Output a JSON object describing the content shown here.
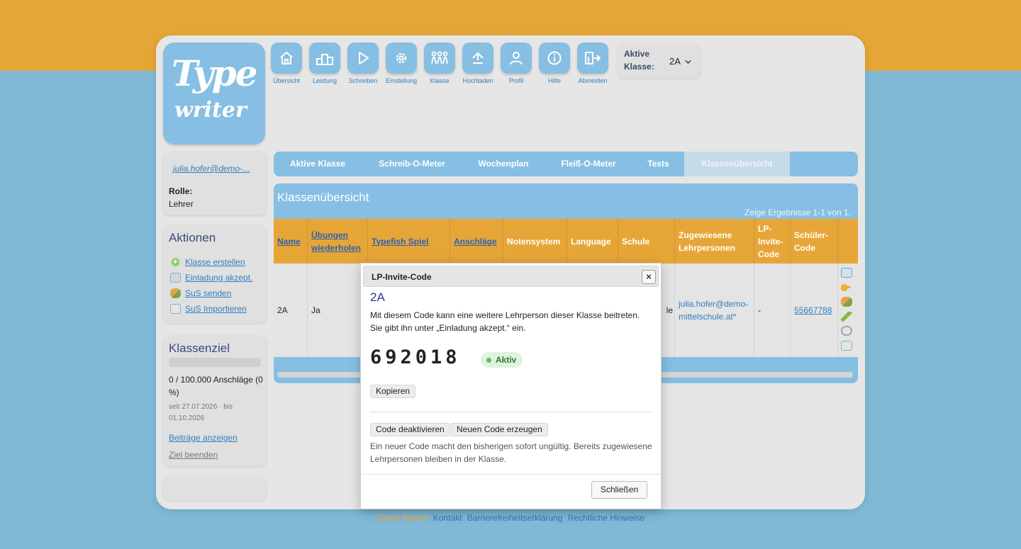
{
  "logo": {
    "line1": "Type",
    "line2": "writer"
  },
  "toolbar": {
    "items": [
      {
        "label": "Übersicht",
        "icon": "home-icon"
      },
      {
        "label": "Leistung",
        "icon": "podium-icon"
      },
      {
        "label": "Schreiben",
        "icon": "play-icon"
      },
      {
        "label": "Einstellung",
        "icon": "gear-icon"
      },
      {
        "label": "Klasse",
        "icon": "group-icon"
      },
      {
        "label": "Hochladen",
        "icon": "upload-icon"
      },
      {
        "label": "Profil",
        "icon": "user-icon"
      },
      {
        "label": "Hilfe",
        "icon": "info-icon"
      },
      {
        "label": "Abmelden",
        "icon": "logout-icon"
      }
    ]
  },
  "active_class": {
    "label": "Aktive Klasse:",
    "value": "2A"
  },
  "user": {
    "email": "julia.hofer@demo-...",
    "role_label": "Rolle:",
    "role_value": "Lehrer"
  },
  "actions": {
    "title": "Aktionen",
    "items": [
      {
        "label": "Klasse erstellen",
        "icon": "plus-circle-icon"
      },
      {
        "label": "Einladung akzept.",
        "icon": "mail-icon"
      },
      {
        "label": "SuS senden",
        "icon": "users-icon"
      },
      {
        "label": "SuS Importieren",
        "icon": "import-icon"
      }
    ]
  },
  "class_goal": {
    "title": "Klassenziel",
    "progress_fraction": 0,
    "progress_text": "0 / 100.000 Anschläge (0 %)",
    "dates": "seit 27.07.2026 · bis 01.10.2026",
    "show_contributions": "Beiträge anzeigen",
    "end_goal": "Ziel beenden"
  },
  "tabs": [
    {
      "label": "Aktive Klasse"
    },
    {
      "label": "Schreib-O-Meter"
    },
    {
      "label": "Wochenplan"
    },
    {
      "label": "Fleiß-O-Meter"
    },
    {
      "label": "Tests"
    },
    {
      "label": "Klassenübersicht",
      "active": true
    }
  ],
  "overview": {
    "title": "Klassenübersicht",
    "results": "Zeige Ergebnisse 1-1 von 1.",
    "headers": [
      "Name",
      "Übungen wiederholen",
      "Typefish Spiel",
      "Anschläge",
      "Notensystem",
      "Language",
      "Schule",
      "Zugewiesene Lehrpersonen",
      "LP-Invite-Code",
      "Schüler-Code"
    ],
    "row": {
      "name": "2A",
      "repeat": "Ja",
      "school_tail": "le",
      "teachers": "julia.hofer@demo-mittelschule.at*",
      "invite": "-",
      "student_code": "55667788"
    },
    "row_icons": [
      "send-mail-icon",
      "key-icon",
      "users-icon",
      "pencil-icon",
      "link-icon",
      "email-icon"
    ]
  },
  "modal": {
    "title": "LP-Invite-Code",
    "close_icon": "close-icon",
    "class_name": "2A",
    "description": "Mit diesem Code kann eine weitere Lehrperson dieser Klasse beitreten. Sie gibt ihn unter „Einladung akzept.“ ein.",
    "code": "692018",
    "status": "Aktiv",
    "copy": "Kopieren",
    "deactivate": "Code deaktivieren",
    "regenerate": "Neuen Code erzeugen",
    "note": "Ein neuer Code macht den bisherigen sofort ungültig. Bereits zugewiesene Lehrpersonen bleiben in der Klasse.",
    "close_button": "Schließen"
  },
  "footer": {
    "lead": "Demo Modus",
    "links": [
      "Kontakt",
      "Barrierefreiheitserklärung",
      "Rechtliche Hinweise"
    ]
  },
  "colors": {
    "accent_orange": "#e6a637",
    "accent_blue": "#86bfe3",
    "link_blue": "#2f7fc0",
    "status_green": "#5ac05a"
  }
}
